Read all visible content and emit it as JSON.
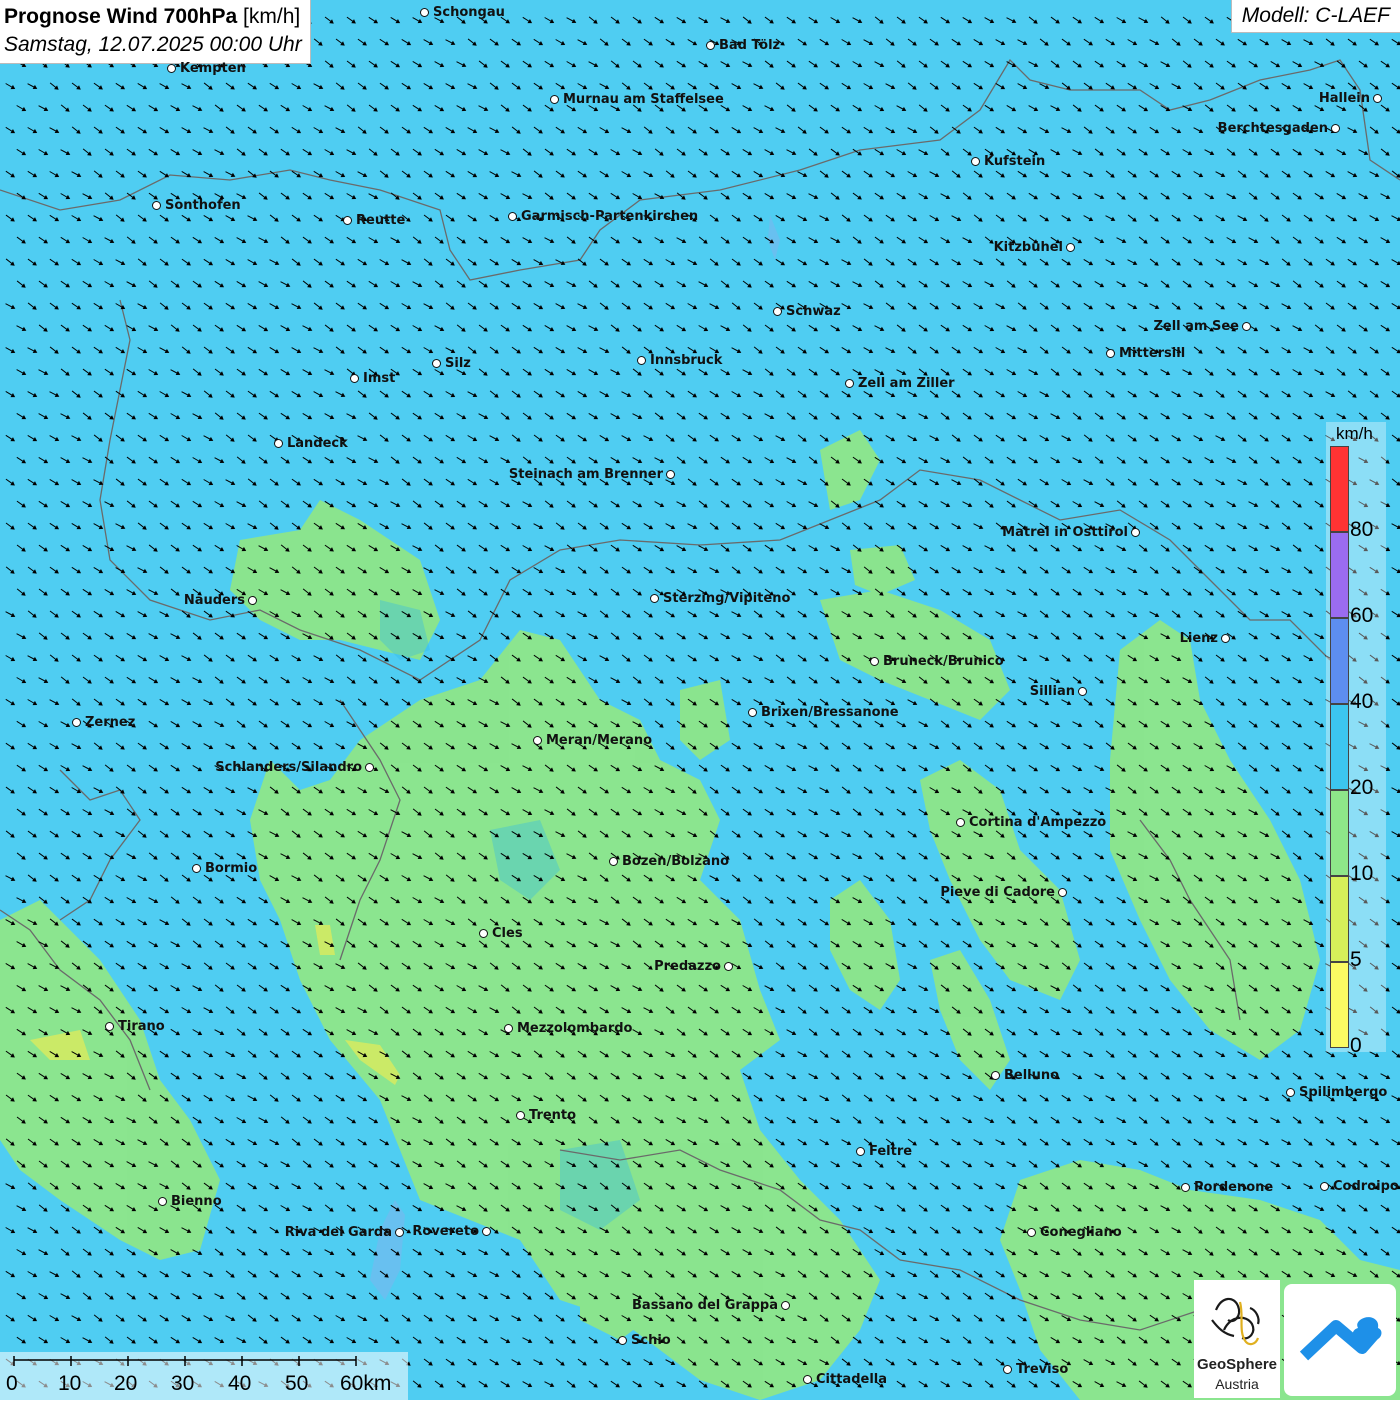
{
  "title": {
    "main": "Prognose Wind 700hPa",
    "unit": "[km/h]",
    "datetime": "Samstag, 12.07.2025 00:00 Uhr"
  },
  "model": "Modell: C-LAEF",
  "wind_direction": "northwest wind, arrows pointing to southeast",
  "colors": {
    "band_20_40": "#4fcdf2",
    "band_10_20": "#8ee689",
    "band_5_10": "#d2ea63",
    "ocean_low": "#2fb8ea",
    "border": "#6a6a6a"
  },
  "legend": {
    "unit": "km/h",
    "ticks": [
      "80",
      "60",
      "40",
      "20",
      "10",
      "5",
      "0"
    ],
    "colors": [
      "#ff3333",
      "#9b6cf0",
      "#5d8ef0",
      "#3cc6f0",
      "#8ee689",
      "#d6f05a",
      "#fbfb63"
    ]
  },
  "scalebar": {
    "ticks": [
      "0",
      "10",
      "20",
      "30",
      "40",
      "50",
      "60km"
    ]
  },
  "cities": [
    {
      "name": "Schongau"
    },
    {
      "name": "Bad Tölz"
    },
    {
      "name": "Kempten"
    },
    {
      "name": "Murnau am Staffelsee"
    },
    {
      "name": "Hallein"
    },
    {
      "name": "Berchtesgaden"
    },
    {
      "name": "Kufstein"
    },
    {
      "name": "Sonthofen"
    },
    {
      "name": "Reutte"
    },
    {
      "name": "Garmisch-Partenkirchen"
    },
    {
      "name": "Kitzbühel"
    },
    {
      "name": "Schwaz"
    },
    {
      "name": "Zell am See"
    },
    {
      "name": "Mittersill"
    },
    {
      "name": "Innsbruck"
    },
    {
      "name": "Silz"
    },
    {
      "name": "Imst"
    },
    {
      "name": "Zell am Ziller"
    },
    {
      "name": "Landeck"
    },
    {
      "name": "Steinach am Brenner"
    },
    {
      "name": "Matrei in Osttirol"
    },
    {
      "name": "Nauders"
    },
    {
      "name": "Sterzing/Vipiteno"
    },
    {
      "name": "Lienz"
    },
    {
      "name": "Bruneck/Brunico"
    },
    {
      "name": "Sillian"
    },
    {
      "name": "Zernez"
    },
    {
      "name": "Brixen/Bressanone"
    },
    {
      "name": "Meran/Merano"
    },
    {
      "name": "Schlanders/Silandro"
    },
    {
      "name": "Cortina d'Ampezzo"
    },
    {
      "name": "Bozen/Bolzano"
    },
    {
      "name": "Bormio"
    },
    {
      "name": "Pieve di Cadore"
    },
    {
      "name": "Cles"
    },
    {
      "name": "Predazzo"
    },
    {
      "name": "Tirano"
    },
    {
      "name": "Mezzolombardo"
    },
    {
      "name": "Belluno"
    },
    {
      "name": "Spilimbergo"
    },
    {
      "name": "Trento"
    },
    {
      "name": "Feltre"
    },
    {
      "name": "Pordenone"
    },
    {
      "name": "Codroipo"
    },
    {
      "name": "Bienno"
    },
    {
      "name": "Riva del Garda"
    },
    {
      "name": "Rovereto"
    },
    {
      "name": "Conegliano"
    },
    {
      "name": "Bassano del Grappa"
    },
    {
      "name": "Schio"
    },
    {
      "name": "Treviso"
    },
    {
      "name": "Cittadella"
    }
  ],
  "logo": {
    "name": "GeoSphere",
    "sub": "Austria"
  }
}
